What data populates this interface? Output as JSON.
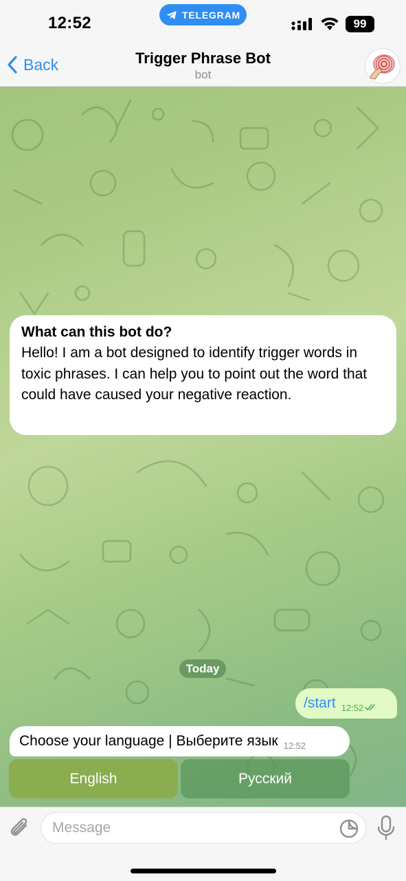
{
  "status_bar": {
    "time": "12:52",
    "app_pill": "TELEGRAM",
    "battery": "99"
  },
  "header": {
    "back_label": "Back",
    "title": "Trigger Phrase Bot",
    "subtitle": "bot"
  },
  "bot_info": {
    "heading": "What can this bot do?",
    "body": "Hello! I am a bot designed to identify trigger words in toxic phrases. I can help you to point out the word that could have caused your negative reaction."
  },
  "date_separator": "Today",
  "messages": [
    {
      "direction": "outgoing",
      "text": "/start",
      "time": "12:52",
      "status": "read"
    },
    {
      "direction": "incoming",
      "text": "Choose your language | Выберите язык",
      "time": "12:52"
    }
  ],
  "inline_keyboard": [
    {
      "label": "English"
    },
    {
      "label": "Русский"
    }
  ],
  "composer": {
    "placeholder": "Message"
  },
  "colors": {
    "accent": "#2f8ef1",
    "outgoing_bubble": "#e2fbc6",
    "read_check": "#4fae4e"
  },
  "icons": [
    "telegram-icon",
    "signal-icon",
    "wifi-icon",
    "back-chevron-icon",
    "attach-icon",
    "sticker-icon",
    "mic-icon",
    "double-check-icon"
  ]
}
